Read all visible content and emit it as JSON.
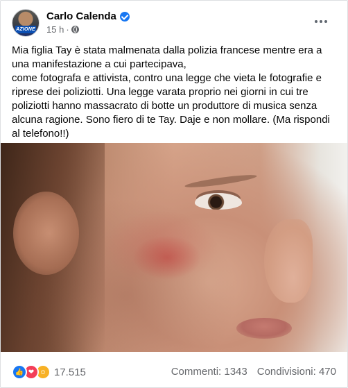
{
  "post": {
    "author": "Carlo Calenda",
    "avatar_badge": "AZIONE",
    "time": "15 h",
    "separator": "·",
    "text": "Mia figlia Tay è stata malmenata dalla polizia francese mentre era a una manifestazione a cui partecipava,\ncome fotografa e attivista, contro una legge che vieta le fotografie e riprese dei poliziotti. Una legge varata proprio nei giorni in cui tre poliziotti hanno massacrato di botte un produttore di musica senza alcuna ragione. Sono fiero di te Tay. Daje e non mollare. (Ma rispondi al telefono!!)"
  },
  "footer": {
    "reaction_count": "17.515",
    "comments": "Commenti: 1343",
    "shares": "Condivisioni: 470"
  },
  "colors": {
    "facebook_blue": "#1877f2",
    "love_red": "#f33e58",
    "care_yellow": "#f7b125",
    "secondary_text": "#65676b"
  },
  "icons": {
    "verified": "verified-badge-icon",
    "audience": "globe-icon",
    "menu": "more-options-icon",
    "reactions": [
      "like-icon",
      "love-icon",
      "care-icon"
    ]
  }
}
